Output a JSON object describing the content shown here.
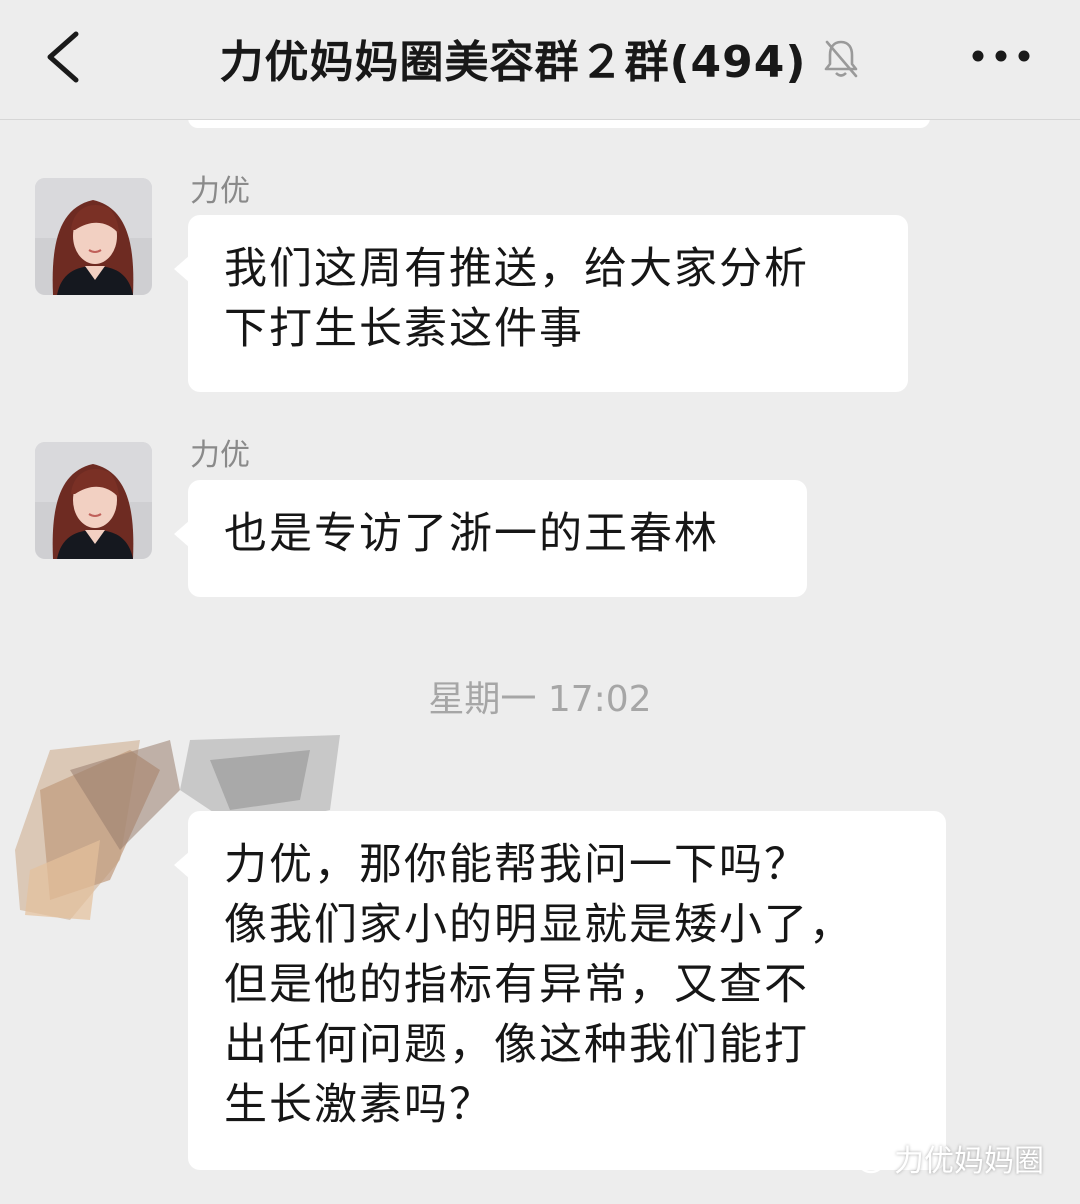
{
  "header": {
    "title": "力优妈妈圈美容群２群(494)",
    "back_icon": "chevron-left-icon",
    "mute_icon": "bell-off-icon",
    "more_icon": "more-dots-icon"
  },
  "messages": [
    {
      "sender": "力优",
      "lines": [
        "我们这周有推送，给大家分析",
        "下打生长素这件事"
      ]
    },
    {
      "sender": "力优",
      "lines": [
        "也是专访了浙一的王春林"
      ]
    },
    {
      "lines": [
        "力优，那你能帮我问一下吗？",
        "像我们家小的明显就是矮小了，",
        "但是他的指标有异常，又查不",
        "出任何问题，像这种我们能打",
        "生长激素吗？"
      ]
    }
  ],
  "timestamp": "星期一 17:02",
  "watermark": "力优妈妈圈",
  "colors": {
    "background": "#ededed",
    "bubble": "#ffffff",
    "text": "#161616",
    "secondary_text": "#8a8a8a"
  }
}
